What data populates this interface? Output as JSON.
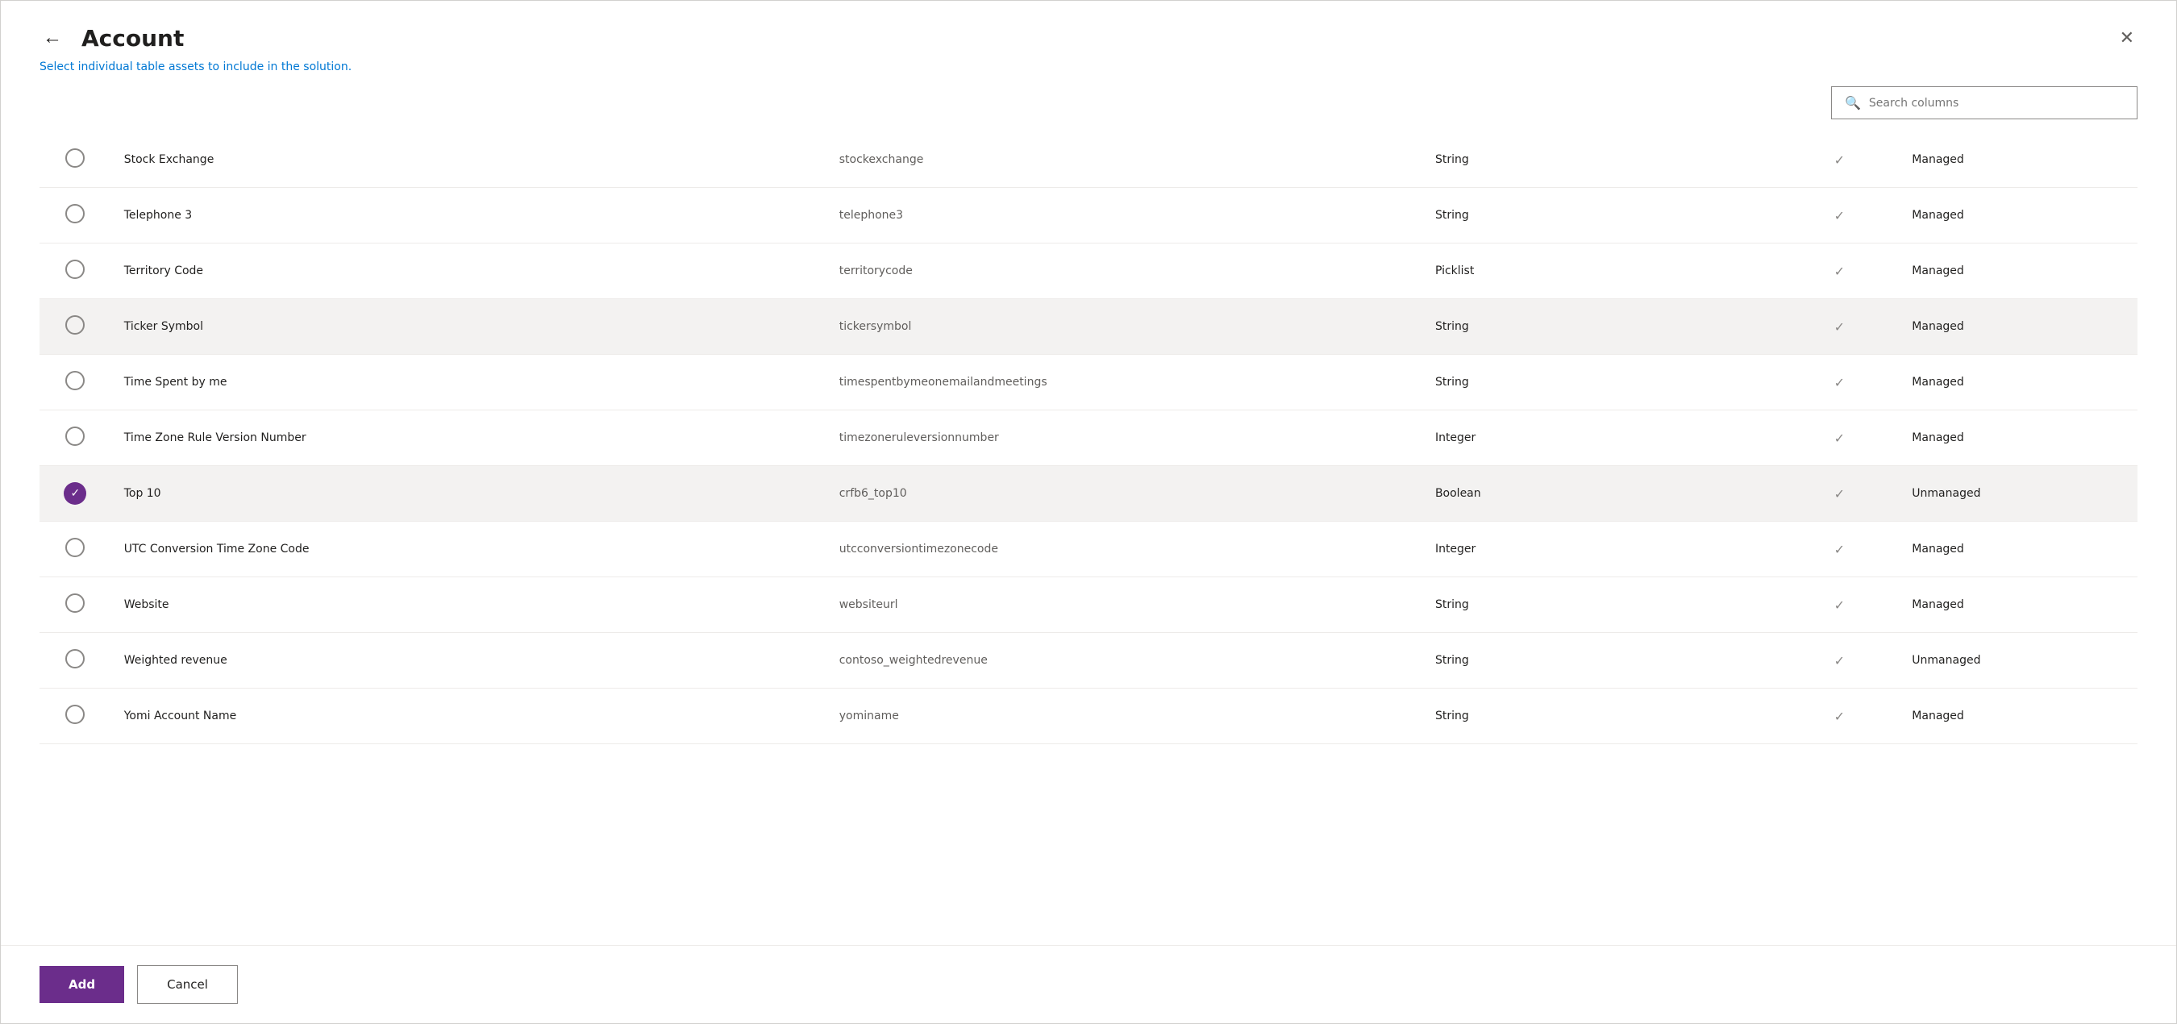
{
  "header": {
    "title": "Account",
    "subtitle_static": "Select ",
    "subtitle_link": "individual table assets",
    "subtitle_rest": " to include in the solution.",
    "back_label": "←",
    "close_label": "✕"
  },
  "search": {
    "placeholder": "Search columns",
    "icon": "🔍"
  },
  "rows": [
    {
      "id": "stock-exchange",
      "name": "Stock Exchange",
      "logical": "stockexchange",
      "type": "String",
      "has_check": true,
      "managed": "Managed",
      "selected": false,
      "highlighted": false
    },
    {
      "id": "telephone-3",
      "name": "Telephone 3",
      "logical": "telephone3",
      "type": "String",
      "has_check": true,
      "managed": "Managed",
      "selected": false,
      "highlighted": false
    },
    {
      "id": "territory-code",
      "name": "Territory Code",
      "logical": "territorycode",
      "type": "Picklist",
      "has_check": true,
      "managed": "Managed",
      "selected": false,
      "highlighted": false
    },
    {
      "id": "ticker-symbol",
      "name": "Ticker Symbol",
      "logical": "tickersymbol",
      "type": "String",
      "has_check": true,
      "managed": "Managed",
      "selected": false,
      "highlighted": true
    },
    {
      "id": "time-spent",
      "name": "Time Spent by me",
      "logical": "timespentbymeonemailandmeetings",
      "type": "String",
      "has_check": true,
      "managed": "Managed",
      "selected": false,
      "highlighted": false
    },
    {
      "id": "timezone-rule",
      "name": "Time Zone Rule Version Number",
      "logical": "timezoneruleversionnumber",
      "type": "Integer",
      "has_check": true,
      "managed": "Managed",
      "selected": false,
      "highlighted": false
    },
    {
      "id": "top10",
      "name": "Top 10",
      "logical": "crfb6_top10",
      "type": "Boolean",
      "has_check": true,
      "managed": "Unmanaged",
      "selected": true,
      "highlighted": true
    },
    {
      "id": "utc-conversion",
      "name": "UTC Conversion Time Zone Code",
      "logical": "utcconversiontimezonecode",
      "type": "Integer",
      "has_check": true,
      "managed": "Managed",
      "selected": false,
      "highlighted": false
    },
    {
      "id": "website",
      "name": "Website",
      "logical": "websiteurl",
      "type": "String",
      "has_check": true,
      "managed": "Managed",
      "selected": false,
      "highlighted": false
    },
    {
      "id": "weighted-revenue",
      "name": "Weighted revenue",
      "logical": "contoso_weightedrevenue",
      "type": "String",
      "has_check": true,
      "managed": "Unmanaged",
      "selected": false,
      "highlighted": false
    },
    {
      "id": "yomi-account",
      "name": "Yomi Account Name",
      "logical": "yominame",
      "type": "String",
      "has_check": true,
      "managed": "Managed",
      "selected": false,
      "highlighted": false
    }
  ],
  "footer": {
    "add_label": "Add",
    "cancel_label": "Cancel"
  }
}
